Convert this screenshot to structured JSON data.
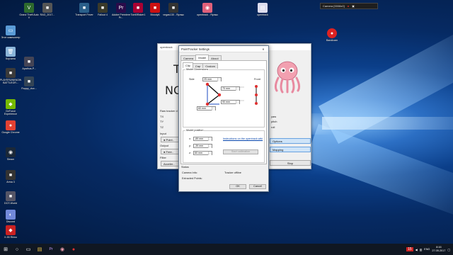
{
  "desktop": {
    "icons_left": [
      {
        "label": "Этот компьютер",
        "color": "#5a9bd6",
        "glyph": "▭"
      },
      {
        "label": "Корзина",
        "color": "#8ab4d8",
        "glyph": "🗑"
      },
      {
        "label": "PLAYERUNKNOWN'S BATTLEGR...",
        "color": "#3a3a3a",
        "glyph": "■"
      },
      {
        "label": "Apathus-P...",
        "color": "#445",
        "glyph": "■"
      },
      {
        "label": "GeForce Experience",
        "color": "#76b900",
        "glyph": "◆"
      },
      {
        "label": "Google Chrome",
        "color": "#e34133",
        "glyph": "●"
      },
      {
        "label": "Steam",
        "color": "#1b2838",
        "glyph": "◉"
      },
      {
        "label": "Arma 3",
        "color": "#333",
        "glyph": "■"
      },
      {
        "label": "DCS World",
        "color": "#556",
        "glyph": "■"
      },
      {
        "label": "Discord",
        "color": "#7289da",
        "glyph": "◐"
      },
      {
        "label": "X-55 Rhino",
        "color": "#c22",
        "glyph": "◆"
      }
    ],
    "icon_extra": {
      "label": "Ruppy_duo...",
      "color": "#345",
      "glyph": "■"
    },
    "icons_top": [
      {
        "label": "Grand Theft Auto V",
        "color": "#2d6a2d",
        "glyph": "V"
      },
      {
        "label": "RAG_2017...",
        "color": "#555",
        "glyph": "■"
      },
      {
        "label": "Transport Fever",
        "color": "#2a5f8a",
        "glyph": "■"
      },
      {
        "label": "Fallout 4",
        "color": "#3a3a2a",
        "glyph": "■"
      },
      {
        "label": "Adobe Premiere Pr...",
        "color": "#2a0b4a",
        "glyph": "Pr"
      },
      {
        "label": "TomBRaker1",
        "color": "#a03",
        "glyph": "■"
      },
      {
        "label": "Bloody6",
        "color": "#c11",
        "glyph": "■"
      },
      {
        "label": "vegas130 - Ярлык",
        "color": "#333",
        "glyph": "■"
      },
      {
        "label": "opentrack - Ярлык",
        "color": "#e0607a",
        "glyph": "◉"
      },
      {
        "label": "opentrack",
        "color": "#dde",
        "glyph": "▤"
      }
    ],
    "bandicam": {
      "label": "Bandicam",
      "color": "#d22",
      "glyph": "●"
    },
    "overlay_text": "Camera [0008x0]"
  },
  "opentrack": {
    "title": "opentrack",
    "big1": "T",
    "big2": "NO",
    "tracker_label": "Raw tracker d",
    "rows": [
      "TX",
      "TY",
      "TZ"
    ],
    "input": "Input",
    "output": "Output",
    "filter": "Filter",
    "accel": "Acceler...",
    "options": "Options",
    "mapping": "Mapping",
    "stop": "Stop",
    "right_rows": [
      "yaw",
      "pitch",
      "roll"
    ]
  },
  "dialog": {
    "title": "PointTracker Settings",
    "close": "✕",
    "tabs": [
      "Camera",
      "Model",
      "About"
    ],
    "subtabs": [
      "Clip",
      "Cap",
      "Custom"
    ],
    "dims_title": "Model Dimensions",
    "side_label": "Side",
    "front_label": "Front",
    "side_value": "25 mm",
    "v1": "70 mm",
    "v2": "90 mm",
    "v3": "60 mm",
    "pos_title": "Model position",
    "x_label": "x:",
    "y_label": "y:",
    "z_label": "z:",
    "x_value": "-89 mm",
    "y_value": "-39 mm",
    "z_value": "60 mm",
    "instructions_link": "Instructions on the opentrack wiki",
    "calib_btn": "Start calibration",
    "status_title": "Status",
    "camera_info_label": "Camera Info:",
    "camera_info_value": "Tracker offline",
    "extracted_label": "Extracted Points:",
    "ok": "OK",
    "cancel": "Cancel"
  },
  "taskbar": {
    "start_glyph": "⊞",
    "apps": [
      "○",
      "▭",
      "▤",
      "Pr",
      "◉",
      "●"
    ],
    "lang": "ENG",
    "time": "8:16",
    "date": "27.05.2017",
    "tray_num": "15"
  },
  "colors": {
    "accent": "#2c6fc4",
    "marker": "#e03030",
    "taskbar": "#101722"
  }
}
